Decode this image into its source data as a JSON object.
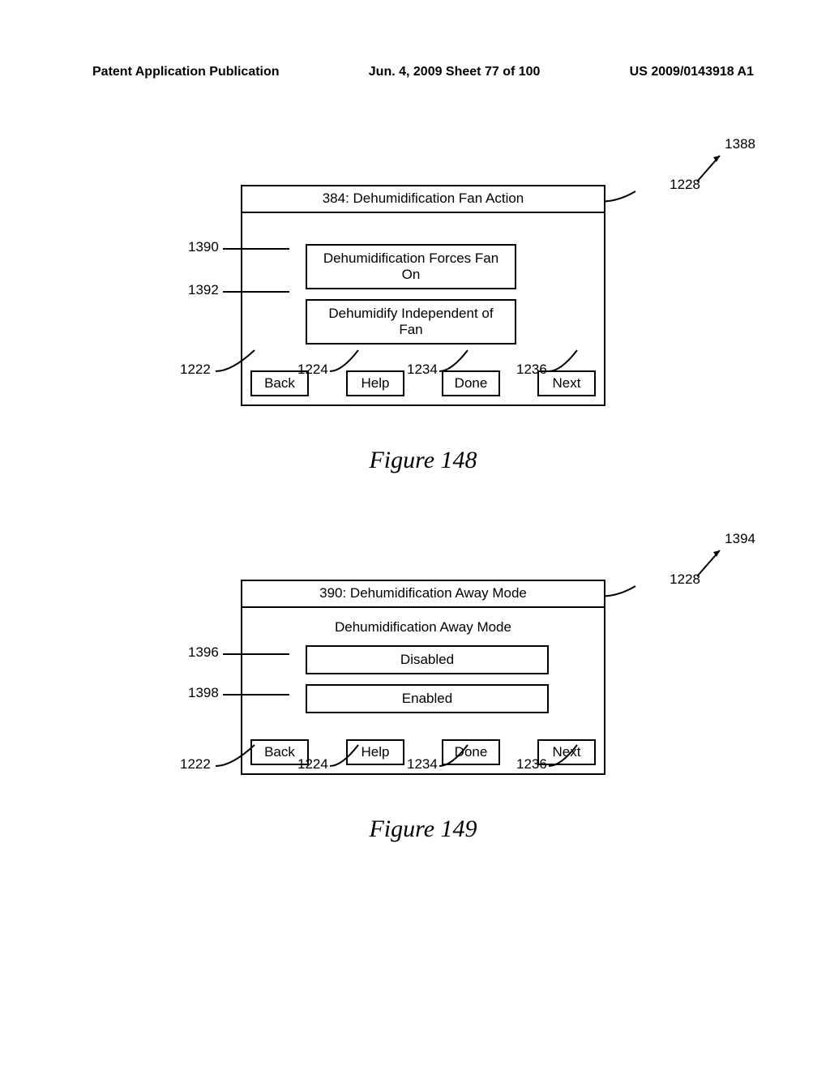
{
  "header": {
    "left": "Patent Application Publication",
    "center": "Jun. 4, 2009   Sheet 77 of 100",
    "right": "US 2009/0143918 A1"
  },
  "figures": [
    {
      "caption": "Figure 148",
      "screen_ref": "1388",
      "title_ref": "1228",
      "title": "384: Dehumidification Fan Action",
      "subtitle": "",
      "options": [
        {
          "ref": "1390",
          "label": "Dehumidification Forces Fan On"
        },
        {
          "ref": "1392",
          "label": "Dehumidify Independent of Fan"
        }
      ],
      "nav": [
        {
          "ref": "1222",
          "label": "Back"
        },
        {
          "ref": "1224",
          "label": "Help"
        },
        {
          "ref": "1234",
          "label": "Done"
        },
        {
          "ref": "1236",
          "label": "Next"
        }
      ]
    },
    {
      "caption": "Figure 149",
      "screen_ref": "1394",
      "title_ref": "1228",
      "title": "390: Dehumidification Away Mode",
      "subtitle": "Dehumidification Away Mode",
      "options": [
        {
          "ref": "1396",
          "label": "Disabled"
        },
        {
          "ref": "1398",
          "label": "Enabled"
        }
      ],
      "nav": [
        {
          "ref": "1222",
          "label": "Back"
        },
        {
          "ref": "1224",
          "label": "Help"
        },
        {
          "ref": "1234",
          "label": "Done"
        },
        {
          "ref": "1236",
          "label": "Next"
        }
      ]
    }
  ]
}
